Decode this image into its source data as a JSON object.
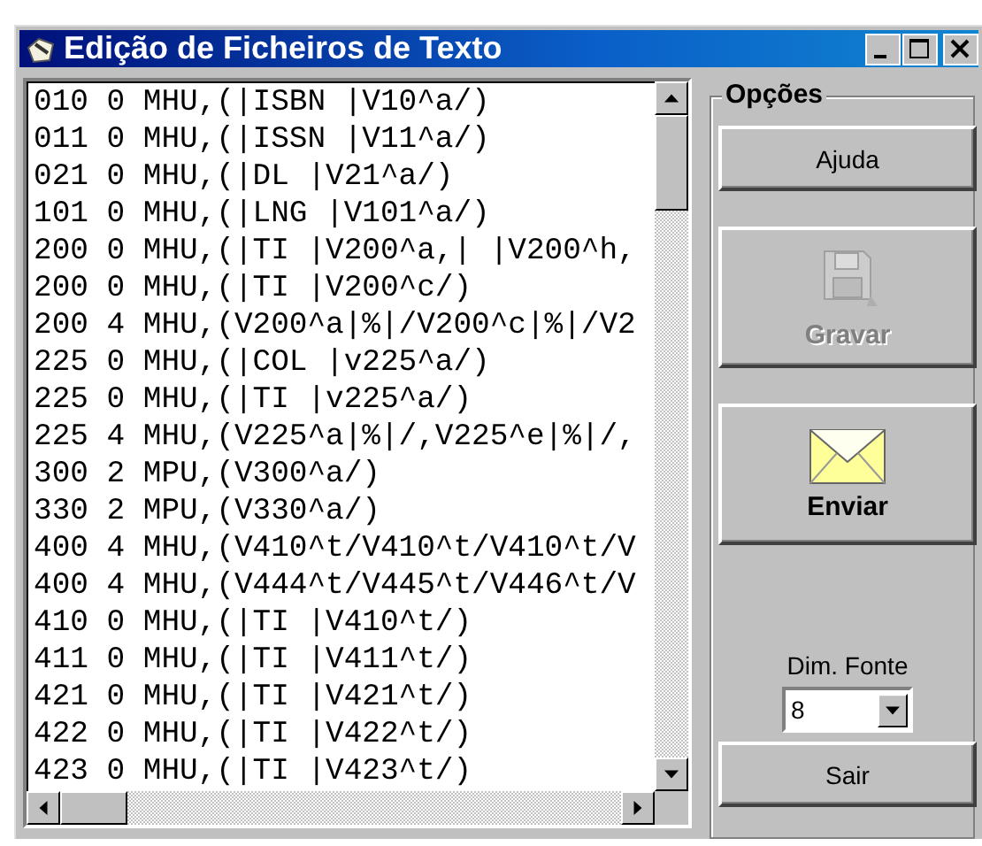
{
  "window": {
    "title": "Edição de Ficheiros de Texto"
  },
  "editor": {
    "lines": [
      "010 0 MHU,(|ISBN |V10^a/)",
      "011 0 MHU,(|ISSN |V11^a/)",
      "021 0 MHU,(|DL |V21^a/)",
      "101 0 MHU,(|LNG |V101^a/)",
      "200 0 MHU,(|TI |V200^a,| |V200^h,",
      "200 0 MHU,(|TI |V200^c/)",
      "200 4 MHU,(V200^a|%|/V200^c|%|/V2",
      "225 0 MHU,(|COL |v225^a/)",
      "225 0 MHU,(|TI |v225^a/)",
      "225 4 MHU,(V225^a|%|/,V225^e|%|/,",
      "300 2 MPU,(V300^a/)",
      "330 2 MPU,(V330^a/)",
      "400 4 MHU,(V410^t/V410^t/V410^t/V",
      "400 4 MHU,(V444^t/V445^t/V446^t/V",
      "410 0 MHU,(|TI |V410^t/)",
      "411 0 MHU,(|TI |V411^t/)",
      "421 0 MHU,(|TI |V421^t/)",
      "422 0 MHU,(|TI |V422^t/)",
      "423 0 MHU,(|TI |V423^t/)"
    ]
  },
  "options": {
    "title": "Opções",
    "buttons": [
      {
        "kind": "plain",
        "label": "Ajuda",
        "disabled": false
      },
      {
        "kind": "floppy",
        "label": "Gravar",
        "disabled": true
      },
      {
        "kind": "envelope",
        "label": "Enviar",
        "disabled": false
      }
    ],
    "font_size": {
      "label": "Dim. Fonte",
      "value": "8"
    },
    "exit_button": {
      "label": "Sair"
    }
  }
}
